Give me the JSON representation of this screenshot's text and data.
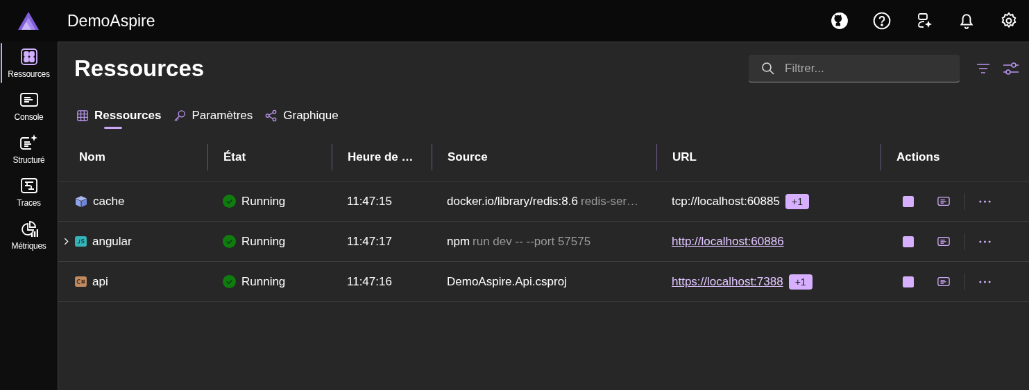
{
  "app": {
    "title": "DemoAspire"
  },
  "nav": [
    {
      "label": "Ressources",
      "selected": true
    },
    {
      "label": "Console",
      "selected": false
    },
    {
      "label": "Structuré",
      "selected": false
    },
    {
      "label": "Traces",
      "selected": false
    },
    {
      "label": "Métriques",
      "selected": false
    }
  ],
  "page": {
    "title": "Ressources"
  },
  "search": {
    "placeholder": "Filtrer..."
  },
  "tabs": [
    {
      "label": "Ressources",
      "selected": true
    },
    {
      "label": "Paramètres",
      "selected": false
    },
    {
      "label": "Graphique",
      "selected": false
    }
  ],
  "table": {
    "columns": [
      "Nom",
      "État",
      "Heure de …",
      "Source",
      "URL",
      "Actions"
    ],
    "rows": [
      {
        "name": "cache",
        "kind": "container",
        "expandable": false,
        "state": "Running",
        "time": "11:47:15",
        "source": "docker.io/library/redis:8.6",
        "source_args": "redis-ser…",
        "url": "tcp://localhost:60885",
        "url_link": false,
        "extra": "+1"
      },
      {
        "name": "angular",
        "kind": "javascript",
        "expandable": true,
        "state": "Running",
        "time": "11:47:17",
        "source": "npm",
        "source_args": "run dev -- --port 57575",
        "url": "http://localhost:60886",
        "url_link": true
      },
      {
        "name": "api",
        "kind": "csharp",
        "expandable": false,
        "state": "Running",
        "time": "11:47:16",
        "source": "DemoAspire.Api.csproj",
        "url": "https://localhost:7388",
        "url_link": true,
        "extra": "+1"
      }
    ]
  }
}
